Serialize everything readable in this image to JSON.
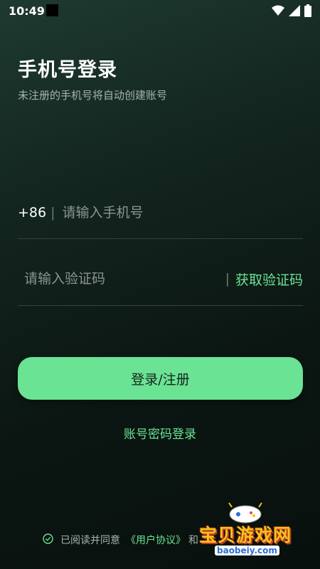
{
  "status_bar": {
    "time": "10:49",
    "icons": [
      "wifi-icon",
      "signal-icon",
      "battery-icon"
    ]
  },
  "header": {
    "title": "手机号登录",
    "subtitle": "未注册的手机号将自动创建账号"
  },
  "phone_field": {
    "country_code": "+86",
    "separator": "|",
    "value": "",
    "placeholder": "请输入手机号"
  },
  "code_field": {
    "value": "",
    "placeholder": "请输入验证码",
    "separator": "|",
    "get_code_label": "获取验证码"
  },
  "login_button": {
    "label": "登录/注册"
  },
  "password_login_link": {
    "label": "账号密码登录"
  },
  "agreement": {
    "prefix": "已阅读并同意",
    "user_agreement": "《用户协议》",
    "conjunction": "和"
  },
  "watermark": {
    "text": "宝贝游戏网",
    "url": "baobeiy.com"
  },
  "colors": {
    "accent": "#6be394",
    "background": "#0f1d18",
    "button_text": "#14241c"
  }
}
